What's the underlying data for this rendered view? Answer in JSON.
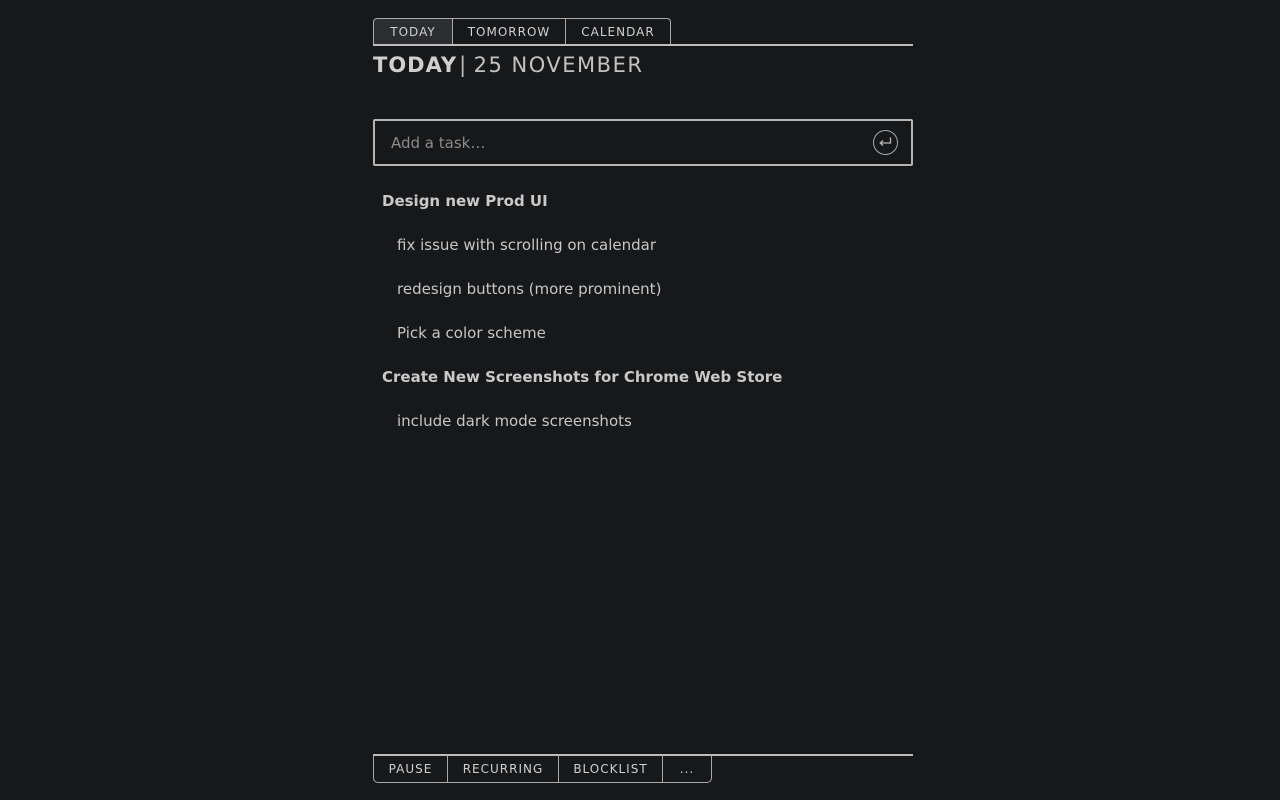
{
  "tabs": [
    {
      "label": "TODAY",
      "active": true
    },
    {
      "label": "TOMORROW",
      "active": false
    },
    {
      "label": "CALENDAR",
      "active": false
    }
  ],
  "heading": {
    "day": "TODAY",
    "separator": "|",
    "date": "25 NOVEMBER"
  },
  "task_input": {
    "placeholder": "Add a task…",
    "value": "",
    "submit_icon": "enter-return-icon"
  },
  "tasks": [
    {
      "text": "Design new Prod UI",
      "level": "parent"
    },
    {
      "text": "fix issue with scrolling on calendar",
      "level": "sub"
    },
    {
      "text": "redesign buttons (more prominent)",
      "level": "sub"
    },
    {
      "text": "Pick a color scheme",
      "level": "sub"
    },
    {
      "text": "Create New Screenshots for Chrome Web Store",
      "level": "parent"
    },
    {
      "text": "include dark mode screenshots",
      "level": "sub"
    }
  ],
  "bottom_tabs": [
    {
      "label": "PAUSE"
    },
    {
      "label": "RECURRING"
    },
    {
      "label": "BLOCKLIST"
    },
    {
      "label": "..."
    }
  ],
  "colors": {
    "background": "#17181a",
    "text": "#c8c8c8",
    "border": "#b5b5b5",
    "active_tab": "#2c2d30"
  }
}
